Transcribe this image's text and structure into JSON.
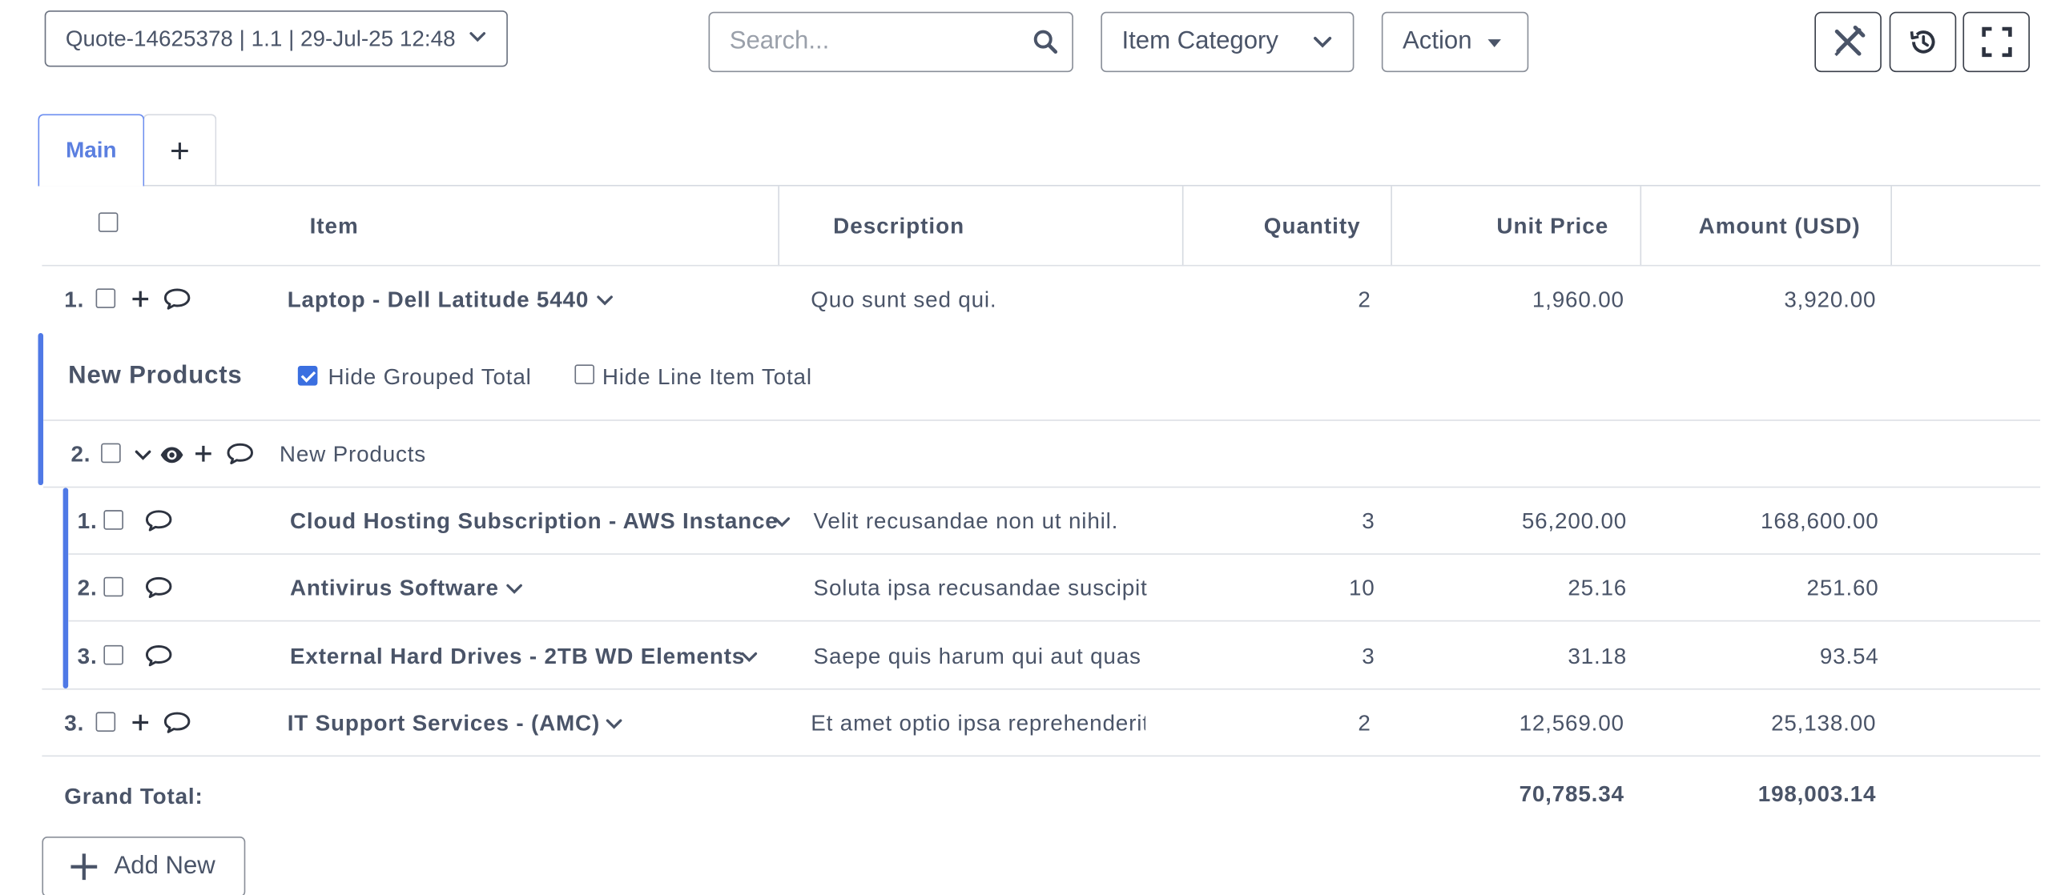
{
  "toolbar": {
    "quote_selector": "Quote-14625378 | 1.1 | 29-Jul-25 12:48",
    "search_placeholder": "Search...",
    "category_label": "Item Category",
    "action_label": "Action"
  },
  "tabs": {
    "main": "Main",
    "add": "+"
  },
  "columns": {
    "item": "Item",
    "description": "Description",
    "quantity": "Quantity",
    "unit_price": "Unit Price",
    "amount": "Amount (USD)"
  },
  "rows": [
    {
      "index": "1.",
      "item": "Laptop - Dell Latitude 5440",
      "description": "Quo sunt sed qui.",
      "quantity": "2",
      "unit_price": "1,960.00",
      "amount": "3,920.00"
    }
  ],
  "group": {
    "title": "New Products",
    "hide_grouped_total_label": "Hide Grouped Total",
    "hide_grouped_total_checked": true,
    "hide_line_item_total_label": "Hide Line Item Total",
    "hide_line_item_total_checked": false,
    "index": "2.",
    "name": "New Products",
    "items": [
      {
        "index": "1.",
        "item": "Cloud Hosting Subscription - AWS Instance",
        "description": "Velit recusandae non ut nihil.",
        "quantity": "3",
        "unit_price": "56,200.00",
        "amount": "168,600.00"
      },
      {
        "index": "2.",
        "item": "Antivirus Software",
        "description": "Soluta ipsa recusandae suscipit",
        "quantity": "10",
        "unit_price": "25.16",
        "amount": "251.60"
      },
      {
        "index": "3.",
        "item": "External Hard Drives - 2TB WD Elements",
        "description": "Saepe quis harum qui aut quas",
        "quantity": "3",
        "unit_price": "31.18",
        "amount": "93.54"
      }
    ]
  },
  "row3": {
    "index": "3.",
    "item": "IT Support Services - (AMC)",
    "description": "Et amet optio ipsa reprehenderit",
    "quantity": "2",
    "unit_price": "12,569.00",
    "amount": "25,138.00"
  },
  "totals": {
    "label": "Grand Total:",
    "unit_price": "70,785.34",
    "amount": "198,003.14"
  },
  "add_new_label": "Add New",
  "icons": {
    "search": "search-icon",
    "chevron": "chevron-down-icon",
    "tools": "tools-icon",
    "history": "history-icon",
    "fullscreen": "fullscreen-icon",
    "comment": "comment-icon",
    "plus": "plus-icon",
    "eye": "eye-icon"
  },
  "colors": {
    "accent": "#4f79e6",
    "text": "#4a5468",
    "border": "#dde0e6"
  }
}
